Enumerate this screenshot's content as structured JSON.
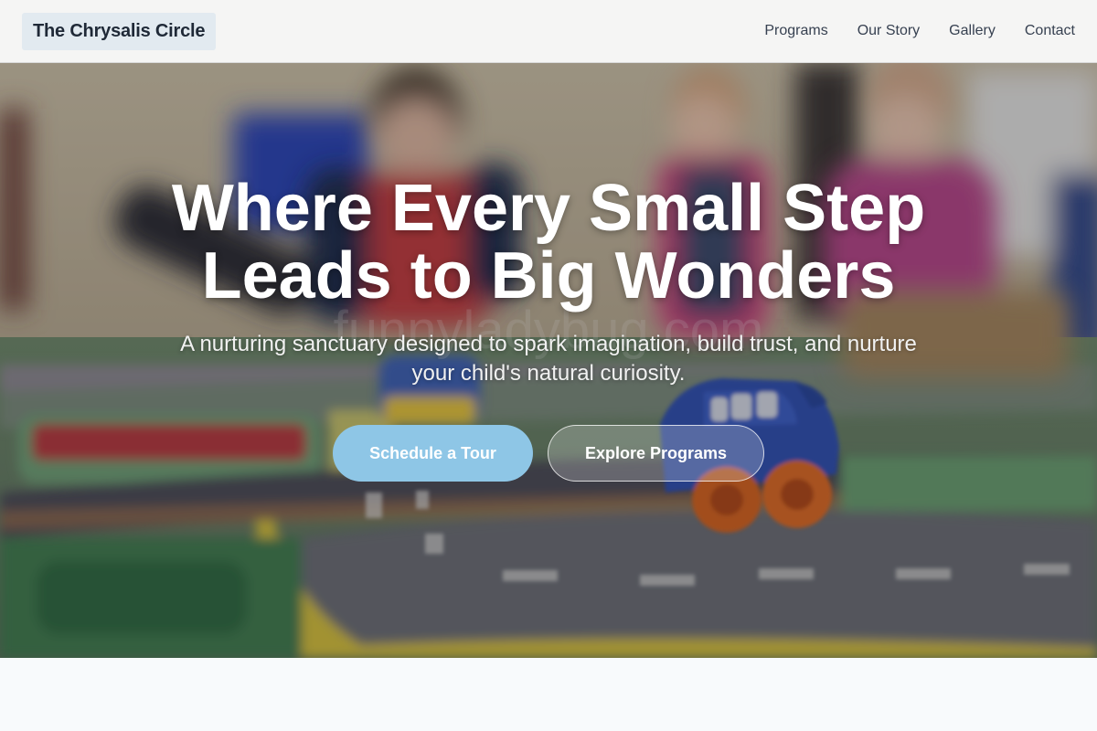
{
  "header": {
    "logo": "The Chrysalis Circle",
    "nav": [
      {
        "label": "Programs"
      },
      {
        "label": "Our Story"
      },
      {
        "label": "Gallery"
      },
      {
        "label": "Contact"
      }
    ]
  },
  "hero": {
    "title_line1": "Where Every Small Step",
    "title_line2": "Leads to Big Wonders",
    "subtitle": "A nurturing sanctuary designed to spark imagination, build trust, and nurture your child's natural curiosity.",
    "primary_cta": "Schedule a Tour",
    "secondary_cta": "Explore Programs",
    "watermark": "funnyladybug.com"
  },
  "colors": {
    "primary_button": "#8ec6e6",
    "header_bg": "#f5f5f4",
    "logo_bg": "#e2eaf0"
  }
}
